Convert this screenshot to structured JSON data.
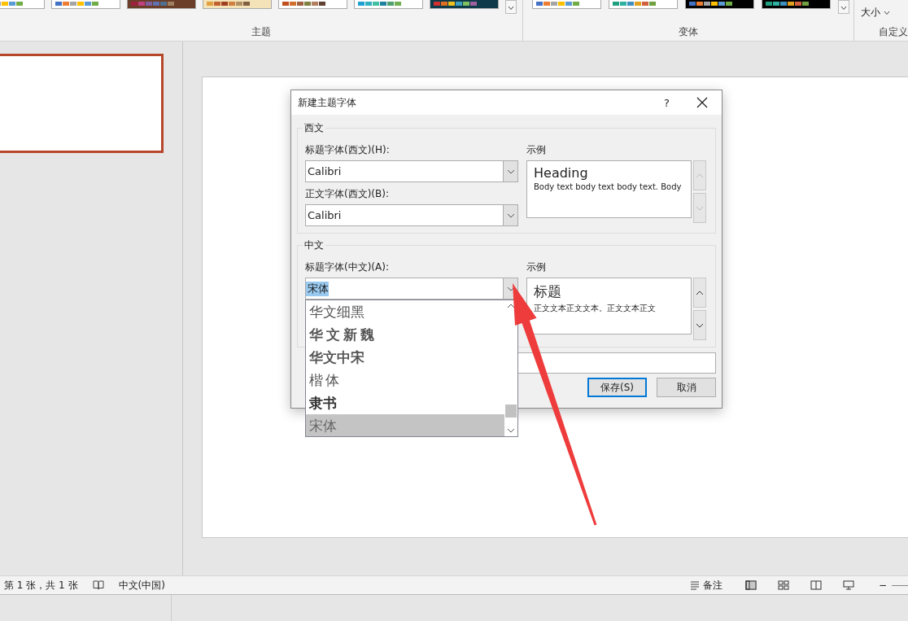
{
  "ribbon": {
    "groups": [
      {
        "label": "主题"
      },
      {
        "label": "变体"
      },
      {
        "label": "自定义"
      }
    ],
    "size_button": {
      "label": "大小"
    }
  },
  "slide_thumbnail": {
    "selected": true
  },
  "dialog": {
    "title": "新建主题字体",
    "help": "?",
    "groups": [
      {
        "legend": "西文",
        "fields": [
          {
            "label": "标题字体(西文)(H):",
            "value": "Calibri",
            "highlighted": false
          },
          {
            "label": "正文字体(西文)(B):",
            "value": "Calibri",
            "highlighted": false
          }
        ],
        "sample_label": "示例",
        "sample_heading": "Heading",
        "sample_body": "Body text body text body text. Body"
      },
      {
        "legend": "中文",
        "fields": [
          {
            "label": "标题字体(中文)(A):",
            "value": "宋体",
            "highlighted": true
          }
        ],
        "sample_label": "示例",
        "sample_heading": "标题",
        "sample_body": "正文文本正文文本。正文文本正文"
      }
    ],
    "buttons": [
      {
        "label": "保存(S)",
        "default": true
      },
      {
        "label": "取消",
        "default": false
      }
    ]
  },
  "dropdown": {
    "items": [
      {
        "label": "华文细黑",
        "selected": false
      },
      {
        "label": "华文新魏",
        "selected": false
      },
      {
        "label": "华文中宋",
        "selected": false
      },
      {
        "label": "楷体",
        "selected": false
      },
      {
        "label": "隶书",
        "selected": false
      },
      {
        "label": "宋体",
        "selected": true
      }
    ]
  },
  "status_bar": {
    "slide_info": "第 1 张，共 1 张",
    "language": "中文(中国)",
    "notes": "备注",
    "zoom_out": "−"
  }
}
